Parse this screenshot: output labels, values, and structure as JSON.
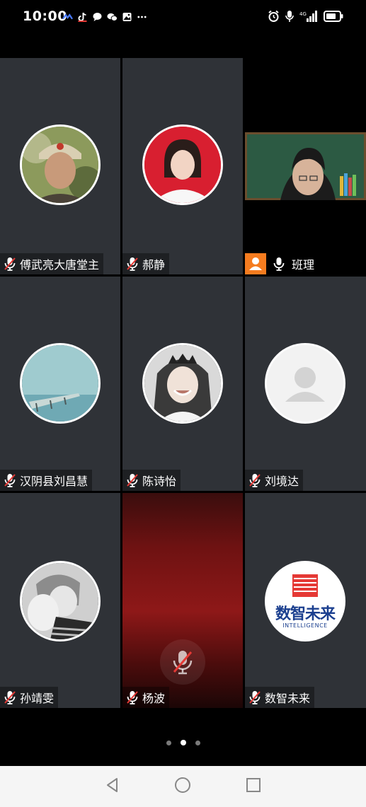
{
  "status_bar": {
    "time": "10:00",
    "icons_left": [
      "app-icon",
      "tiktok-icon",
      "chat-icon",
      "wechat-icon",
      "gallery-icon",
      "more-icon"
    ],
    "icons_right": [
      "alarm-icon",
      "mic-icon",
      "signal-4g-icon",
      "battery-icon"
    ]
  },
  "participants": [
    {
      "name": "傅武亮大唐堂主",
      "type": "avatar",
      "muted": true
    },
    {
      "name": "郝静",
      "type": "avatar",
      "muted": true
    },
    {
      "name": "班理",
      "type": "video",
      "muted": false,
      "host": true
    },
    {
      "name": "汉阴县刘昌慧",
      "type": "avatar",
      "muted": true
    },
    {
      "name": "陈诗怡",
      "type": "avatar",
      "muted": true
    },
    {
      "name": "刘境达",
      "type": "default-avatar",
      "muted": true
    },
    {
      "name": "孙靖雯",
      "type": "avatar",
      "muted": true
    },
    {
      "name": "杨波",
      "type": "background",
      "muted": true
    },
    {
      "name": "数智未来",
      "type": "logo",
      "muted": true
    }
  ],
  "logo": {
    "title": "数智未来",
    "subtitle": "INTELLIGENCE"
  },
  "pager": {
    "pages": 3,
    "active": 2
  },
  "colors": {
    "tile_bg": "#2f3237",
    "host_badge": "#f57c1f",
    "muted_red": "#e53935"
  }
}
